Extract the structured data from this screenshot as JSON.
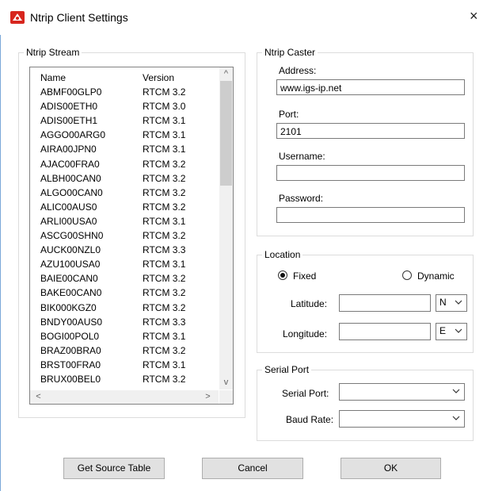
{
  "window": {
    "title": "Ntrip Client Settings",
    "close_glyph": "×",
    "icon": "ntrip-app-icon"
  },
  "stream_group": {
    "legend": "Ntrip Stream",
    "columns": [
      "Name",
      "Version"
    ],
    "rows": [
      {
        "name": "ABMF00GLP0",
        "version": "RTCM 3.2"
      },
      {
        "name": "ADIS00ETH0",
        "version": "RTCM 3.0"
      },
      {
        "name": "ADIS00ETH1",
        "version": "RTCM 3.1"
      },
      {
        "name": "AGGO00ARG0",
        "version": "RTCM 3.1"
      },
      {
        "name": "AIRA00JPN0",
        "version": "RTCM 3.1"
      },
      {
        "name": "AJAC00FRA0",
        "version": "RTCM 3.2"
      },
      {
        "name": "ALBH00CAN0",
        "version": "RTCM 3.2"
      },
      {
        "name": "ALGO00CAN0",
        "version": "RTCM 3.2"
      },
      {
        "name": "ALIC00AUS0",
        "version": "RTCM 3.2"
      },
      {
        "name": "ARLI00USA0",
        "version": "RTCM 3.1"
      },
      {
        "name": "ASCG00SHN0",
        "version": "RTCM 3.2"
      },
      {
        "name": "AUCK00NZL0",
        "version": "RTCM 3.3"
      },
      {
        "name": "AZU100USA0",
        "version": "RTCM 3.1"
      },
      {
        "name": "BAIE00CAN0",
        "version": "RTCM 3.2"
      },
      {
        "name": "BAKE00CAN0",
        "version": "RTCM 3.2"
      },
      {
        "name": "BIK000KGZ0",
        "version": "RTCM 3.2"
      },
      {
        "name": "BNDY00AUS0",
        "version": "RTCM 3.3"
      },
      {
        "name": "BOGI00POL0",
        "version": "RTCM 3.1"
      },
      {
        "name": "BRAZ00BRA0",
        "version": "RTCM 3.2"
      },
      {
        "name": "BRST00FRA0",
        "version": "RTCM 3.1"
      },
      {
        "name": "BRUX00BEL0",
        "version": "RTCM 3.2"
      }
    ],
    "scroll_up": "^",
    "scroll_down": "v",
    "scroll_left": "<",
    "scroll_right": ">"
  },
  "caster_group": {
    "legend": "Ntrip Caster",
    "address_label": "Address:",
    "address_value": "www.igs-ip.net",
    "port_label": "Port:",
    "port_value": "2101",
    "username_label": "Username:",
    "username_value": "",
    "password_label": "Password:",
    "password_value": ""
  },
  "location_group": {
    "legend": "Location",
    "fixed_label": "Fixed",
    "dynamic_label": "Dynamic",
    "selected_mode": "Fixed",
    "latitude_label": "Latitude:",
    "latitude_value": "",
    "latitude_hemisphere": "N",
    "longitude_label": "Longitude:",
    "longitude_value": "",
    "longitude_hemisphere": "E"
  },
  "serial_group": {
    "legend": "Serial Port",
    "serial_port_label": "Serial Port:",
    "serial_port_value": "",
    "baud_rate_label": "Baud Rate:",
    "baud_rate_value": ""
  },
  "buttons": {
    "get_source_table": "Get Source Table",
    "cancel": "Cancel",
    "ok": "OK"
  },
  "colors": {
    "button_face": "#e1e1e1",
    "scrollbar_track": "#f0f0f0",
    "scroll_thumb": "#cdcdcd",
    "app_icon": "#d7261e"
  }
}
